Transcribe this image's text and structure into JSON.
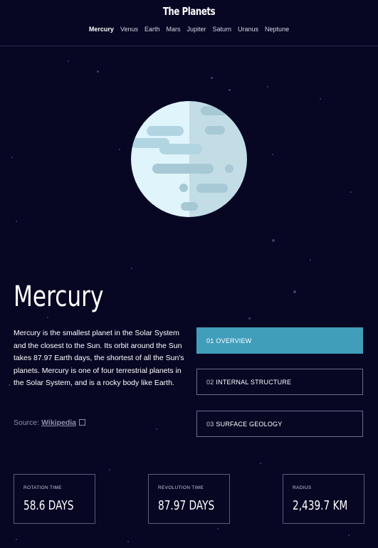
{
  "app": {
    "title": "The Planets"
  },
  "nav": {
    "items": [
      "Mercury",
      "Venus",
      "Earth",
      "Mars",
      "Jupiter",
      "Saturn",
      "Uranus",
      "Neptune"
    ],
    "active": "Mercury"
  },
  "planet": {
    "name": "Mercury",
    "description": "Mercury is the smallest planet in the Solar System and the closest to the Sun. Its orbit around the Sun takes 87.97 Earth days, the shortest of all the Sun's planets. Mercury is one of four terrestrial planets in the Solar System, and is a rocky body like Earth.",
    "source_label": "Source:",
    "source_link": "Wikipedia"
  },
  "tabs": [
    {
      "num": "01",
      "label": "OVERVIEW"
    },
    {
      "num": "02",
      "label": "INTERNAL STRUCTURE"
    },
    {
      "num": "03",
      "label": "SURFACE GEOLOGY"
    }
  ],
  "active_tab": "OVERVIEW",
  "stats": [
    {
      "label": "ROTATION TIME",
      "value": "58.6 DAYS"
    },
    {
      "label": "REVOLUTION TIME",
      "value": "87.97 DAYS"
    },
    {
      "label": "RADIUS",
      "value": "2,439.7 KM"
    }
  ],
  "colors": {
    "background": "#070724",
    "accent": "#419EBB"
  },
  "icons": {
    "source_link": "external-link-icon"
  }
}
